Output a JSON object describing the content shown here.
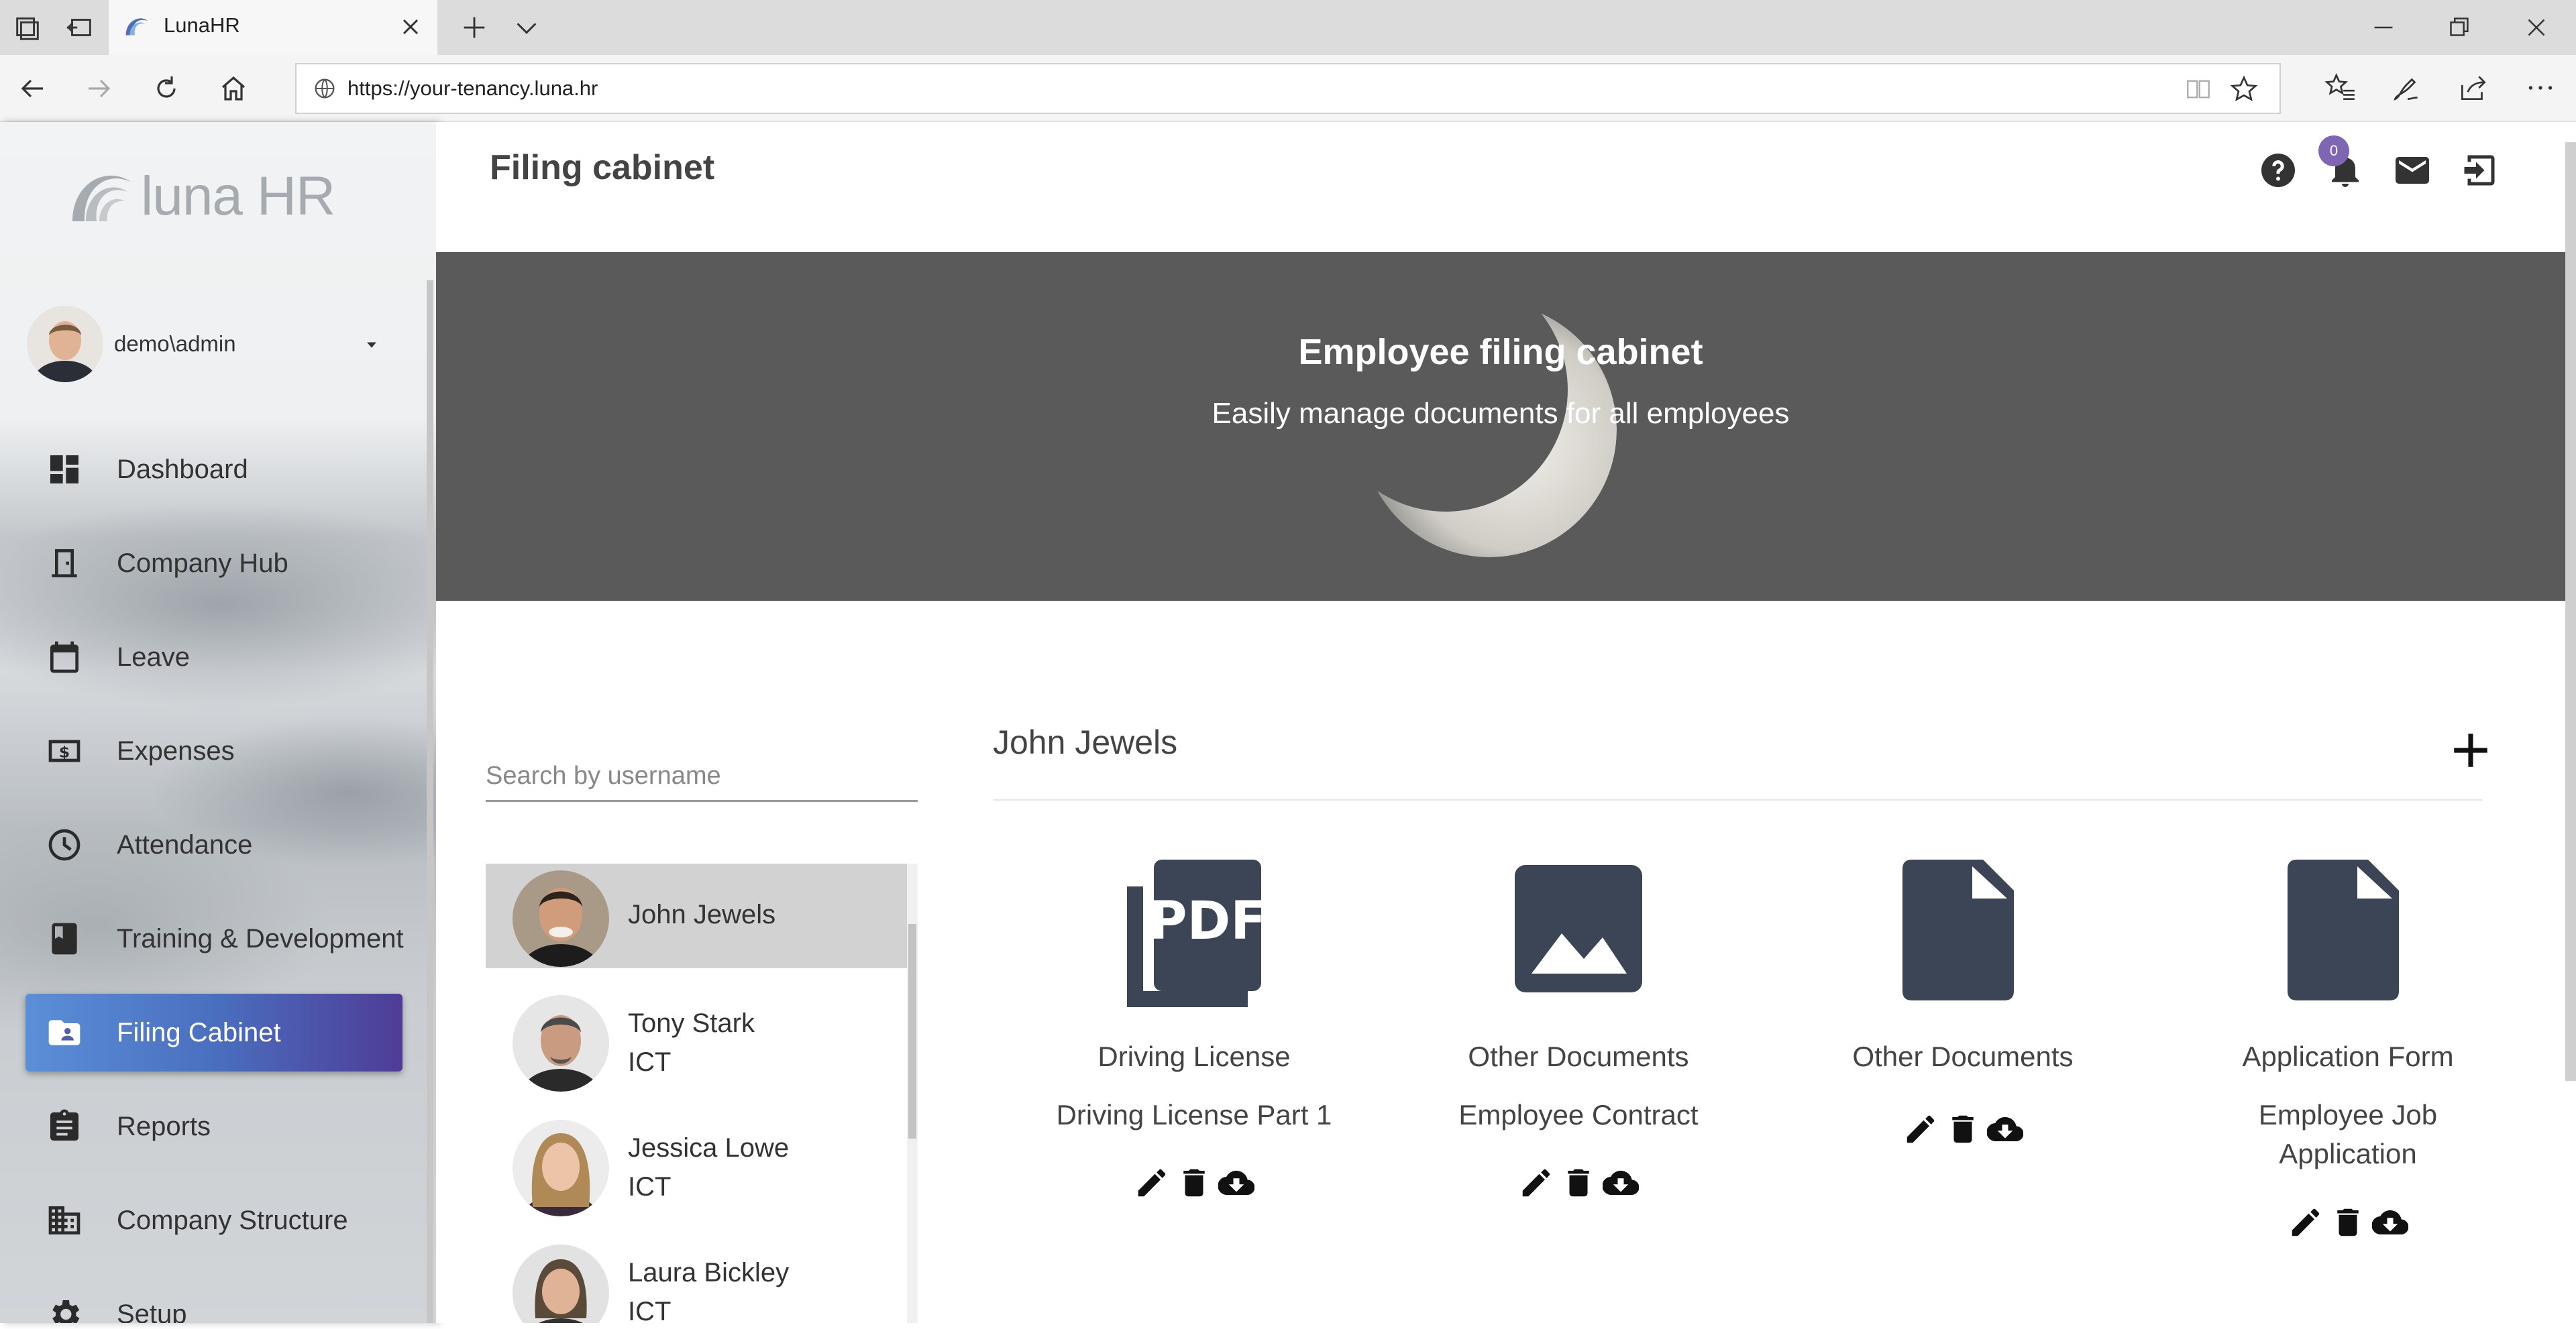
{
  "browser": {
    "tab_title": "LunaHR",
    "url": "https://your-tenancy.luna.hr"
  },
  "sidebar": {
    "logo_text": "luna HR",
    "user": {
      "name": "demo\\admin"
    },
    "items": [
      {
        "label": "Dashboard",
        "icon": "dashboard-icon",
        "active": false
      },
      {
        "label": "Company Hub",
        "icon": "door-icon",
        "active": false
      },
      {
        "label": "Leave",
        "icon": "calendar-icon",
        "active": false
      },
      {
        "label": "Expenses",
        "icon": "money-icon",
        "active": false
      },
      {
        "label": "Attendance",
        "icon": "clock-icon",
        "active": false
      },
      {
        "label": "Training & Development",
        "icon": "book-icon",
        "active": false
      },
      {
        "label": "Filing Cabinet",
        "icon": "folder-account-icon",
        "active": true
      },
      {
        "label": "Reports",
        "icon": "clipboard-icon",
        "active": false
      },
      {
        "label": "Company Structure",
        "icon": "building-icon",
        "active": false
      },
      {
        "label": "Setup",
        "icon": "gear-icon",
        "active": false
      }
    ]
  },
  "header": {
    "title": "Filing cabinet",
    "notification_count": "0"
  },
  "banner": {
    "title": "Employee filing cabinet",
    "subtitle": "Easily manage documents for all employees"
  },
  "search": {
    "placeholder": "Search by username",
    "value": ""
  },
  "employees": [
    {
      "name": "John Jewels",
      "department": "",
      "selected": true
    },
    {
      "name": "Tony Stark",
      "department": "ICT",
      "selected": false
    },
    {
      "name": "Jessica Lowe",
      "department": "ICT",
      "selected": false
    },
    {
      "name": "Laura Bickley",
      "department": "ICT",
      "selected": false
    }
  ],
  "detail": {
    "employee_name": "John Jewels",
    "documents": [
      {
        "category": "Driving License",
        "name": "Driving License Part 1",
        "icon": "pdf-icon"
      },
      {
        "category": "Other Documents",
        "name": "Employee Contract",
        "icon": "image-icon"
      },
      {
        "category": "Other Documents",
        "name": "",
        "icon": "file-icon"
      },
      {
        "category": "Application Form",
        "name": "Employee Job Application",
        "icon": "file-icon"
      }
    ]
  },
  "colors": {
    "accent_gradient_start": "#5b8fd8",
    "accent_gradient_end": "#4f3c97",
    "doc_icon": "#3c4556",
    "banner_bg": "#5a5a5a",
    "badge": "#7e66b4"
  }
}
